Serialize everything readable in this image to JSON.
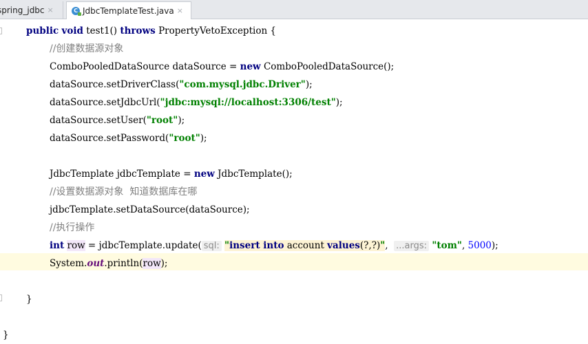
{
  "tabs": [
    {
      "label": "spring_jdbc",
      "close": "×",
      "active": false
    },
    {
      "label": "JdbcTemplateTest.java",
      "close": "×",
      "active": true,
      "icon": "class-icon",
      "icon_letter": "C"
    }
  ],
  "code": {
    "l1": {
      "kw1": "public",
      "kw2": "void",
      "name": "test1()",
      "kw3": "throws",
      "rest": "PropertyVetoException {"
    },
    "l2": {
      "comment": "//创建数据源对象"
    },
    "l3": {
      "a": "ComboPooledDataSource dataSource = ",
      "kw": "new",
      "b": "ComboPooledDataSource();"
    },
    "l4": {
      "a": "dataSource.setDriverClass(",
      "str": "\"com.mysql.jdbc.Driver\"",
      "b": ");"
    },
    "l5": {
      "a": "dataSource.setJdbcUrl(",
      "str": "\"jdbc:mysql://localhost:3306/test\"",
      "b": ");"
    },
    "l6": {
      "a": "dataSource.setUser(",
      "str": "\"root\"",
      "b": ");"
    },
    "l7": {
      "a": "dataSource.setPassword(",
      "str": "\"root\"",
      "b": ");"
    },
    "l9": {
      "a": "JdbcTemplate jdbcTemplate = ",
      "kw": "new",
      "b": "JdbcTemplate();"
    },
    "l10": {
      "comment": "//设置数据源对象  知道数据库在哪"
    },
    "l11": {
      "a": "jdbcTemplate.setDataSource(dataSource);"
    },
    "l12": {
      "comment": "//执行操作"
    },
    "l13": {
      "kw": "int",
      "var": "row",
      "a": " = jdbcTemplate.update(",
      "hint1": "sql:",
      "q1": "\"",
      "sql_kw1": "insert into",
      "sql_tbl": " account ",
      "sql_kw2": "values",
      "sql_rest": "(?,?)",
      "q2": "\"",
      "comma": ", ",
      "hint2": "...args:",
      "str": "\"tom\"",
      "comma2": ", ",
      "num": "5000",
      "end": ");"
    },
    "l14": {
      "a": "System.",
      "field": "out",
      "b": ".println(",
      "var": "row",
      "c": ");"
    },
    "l16": {
      "brace": "}"
    },
    "l18": {
      "brace": "}"
    }
  }
}
